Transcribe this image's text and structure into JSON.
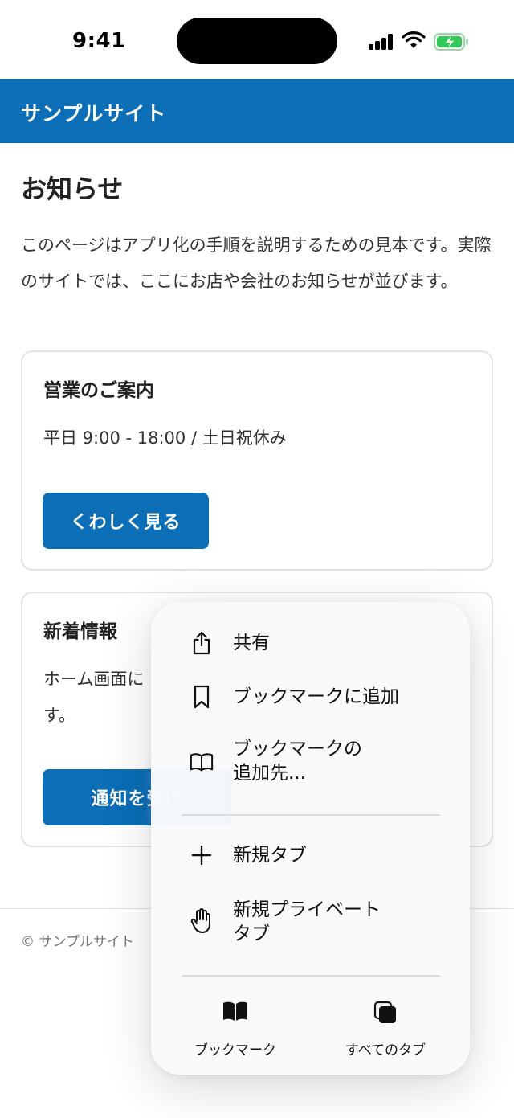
{
  "status_bar": {
    "time": "9:41"
  },
  "site": {
    "title": "サンプルサイト"
  },
  "main": {
    "title": "お知らせ",
    "intro": "このページはアプリ化の手順を説明するための見本です。実際のサイトでは、ここにお店や会社のお知らせが並びます。"
  },
  "cards": [
    {
      "title": "営業のご案内",
      "text": "平日 9:00 - 18:00 / 土日祝休み",
      "button": "くわしく見る"
    },
    {
      "title": "新着情報",
      "text": "ホーム画面に",
      "text_line2": "す。",
      "button": "通知を受け"
    }
  ],
  "footer": {
    "copyright": "© サンプルサイト"
  },
  "context_menu": {
    "items": [
      {
        "label": "共有",
        "icon": "share-icon"
      },
      {
        "label": "ブックマークに追加",
        "icon": "bookmark-icon"
      },
      {
        "label": "ブックマークの",
        "label_line2": "追加先...",
        "icon": "open-book-icon"
      },
      {
        "label": "新規タブ",
        "icon": "plus-icon"
      },
      {
        "label": "新規プライベート",
        "label_line2": "タブ",
        "icon": "hand-icon"
      }
    ],
    "bottom": [
      {
        "label": "ブックマーク",
        "icon": "bookmarks-icon"
      },
      {
        "label": "すべてのタブ",
        "icon": "tabs-icon"
      }
    ]
  },
  "colors": {
    "brand": "#0b6eb6",
    "battery": "#34c759"
  }
}
